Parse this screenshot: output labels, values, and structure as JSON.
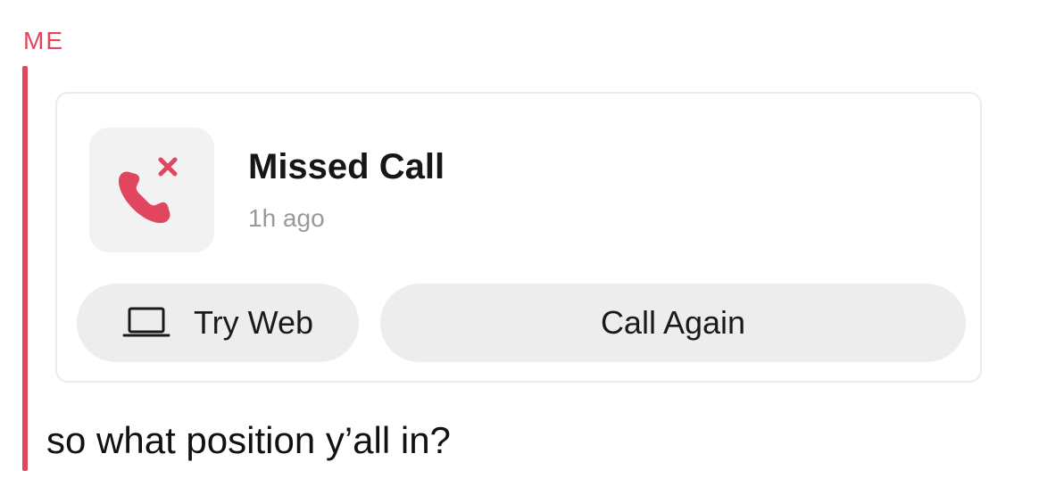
{
  "colors": {
    "accent": "#e0475f",
    "card_border": "#ececec",
    "pill_bg": "#ededed",
    "icon_tile_bg": "#f2f2f2",
    "muted_text": "#9a9a9a"
  },
  "chat": {
    "sender_label": "ME",
    "call_card": {
      "icon": "missed-call-icon",
      "title": "Missed Call",
      "time": "1h ago",
      "try_web_button": {
        "icon": "laptop-icon",
        "label": "Try Web"
      },
      "call_again_button": {
        "label": "Call Again"
      }
    },
    "message_text": "so what position y’all in?"
  }
}
